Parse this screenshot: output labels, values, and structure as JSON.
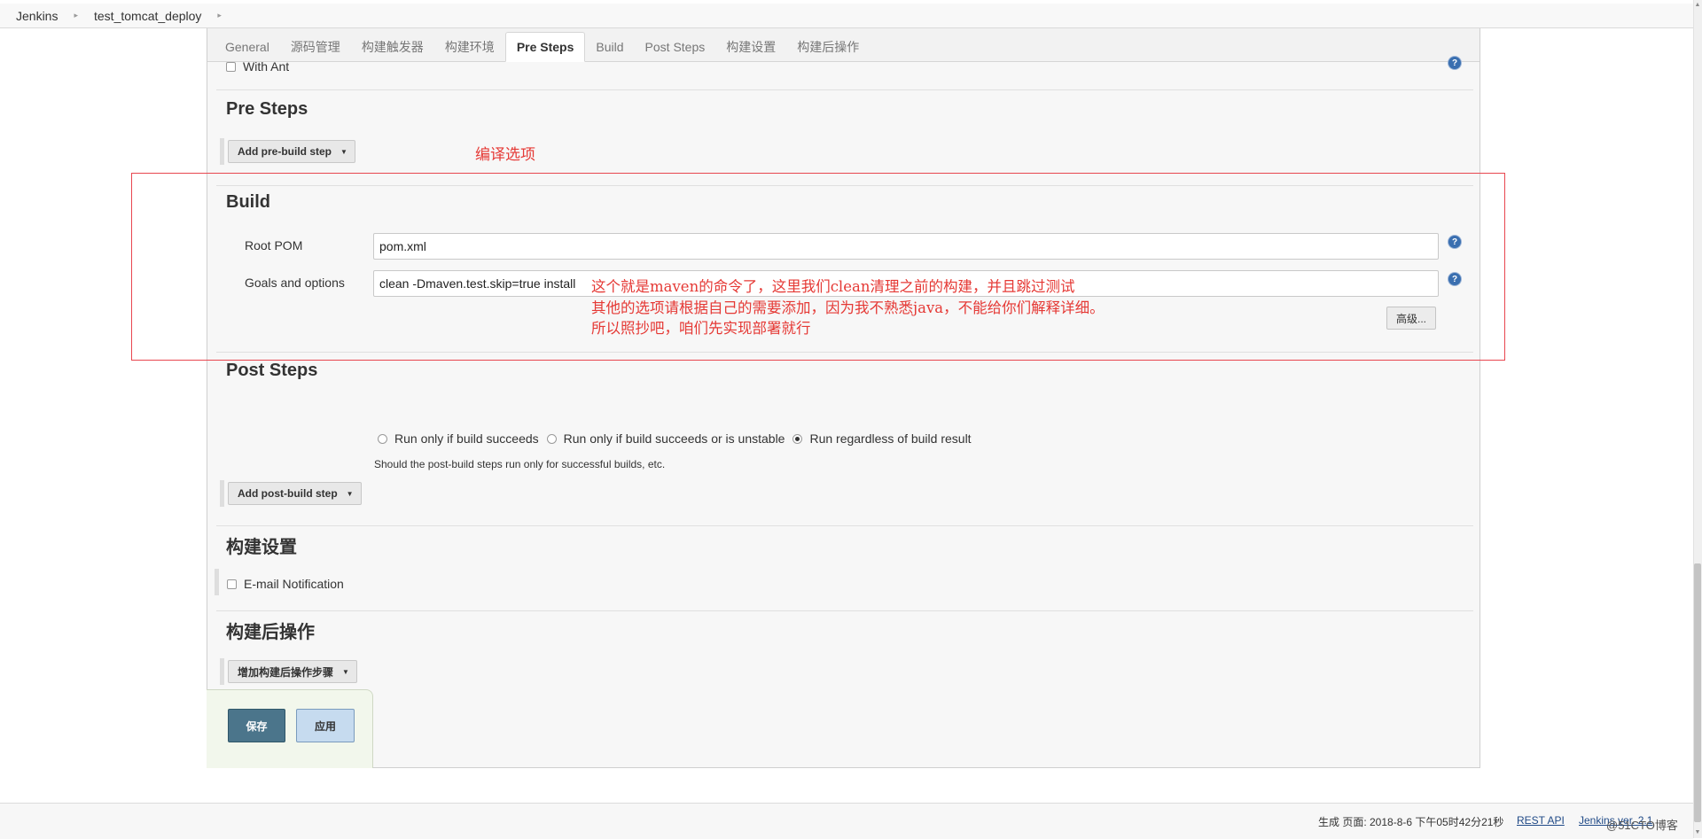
{
  "breadcrumb": {
    "items": [
      "Jenkins",
      "test_tomcat_deploy"
    ]
  },
  "tabs": [
    "General",
    "源码管理",
    "构建触发器",
    "构建环境",
    "Pre Steps",
    "Build",
    "Post Steps",
    "构建设置",
    "构建后操作"
  ],
  "active_tab": "Pre Steps",
  "with_ant_label": "With Ant",
  "pre_steps": {
    "title": "Pre Steps",
    "add_button": "Add pre-build step"
  },
  "build": {
    "title": "Build",
    "root_pom_label": "Root POM",
    "root_pom_value": "pom.xml",
    "goals_label": "Goals and options",
    "goals_value": "clean -Dmaven.test.skip=true install",
    "advanced_button": "高级..."
  },
  "post_steps": {
    "title": "Post Steps",
    "options": [
      "Run only if build succeeds",
      "Run only if build succeeds or is unstable",
      "Run regardless of build result"
    ],
    "selected": "Run regardless of build result",
    "hint": "Should the post-build steps run only for successful builds, etc.",
    "add_button": "Add post-build step"
  },
  "build_settings": {
    "title": "构建设置",
    "email_label": "E-mail Notification"
  },
  "post_build": {
    "title": "构建后操作",
    "add_button": "增加构建后操作步骤"
  },
  "actions": {
    "save": "保存",
    "apply": "应用"
  },
  "annotations": {
    "title": "编译选项",
    "note_line1": "这个就是maven的命令了，这里我们clean清理之前的构建，并且跳过测试",
    "note_line2": "其他的选项请根据自己的需要添加，因为我不熟悉java，不能给你们解释详细。",
    "note_line3": "所以照抄吧，咱们先实现部署就行",
    "color": "#e53935"
  },
  "footer": {
    "generated": "生成 页面: 2018-8-6 下午05时42分21秒",
    "rest_api": "REST API",
    "version": "Jenkins ver. 2.1"
  },
  "watermark": "@51CTO博客",
  "colors": {
    "save_button": "#4b758b",
    "apply_button": "#c6dbef",
    "help_icon": "#3a6fb0"
  }
}
